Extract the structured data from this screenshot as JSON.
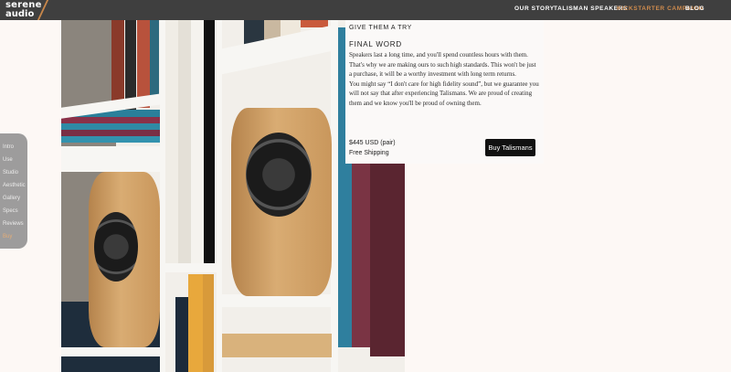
{
  "brand": {
    "line1": "serene",
    "line2": "audio"
  },
  "nav": [
    {
      "label": "Our Story",
      "active": false
    },
    {
      "label": "Talisman Speakers",
      "active": false
    },
    {
      "label": "Kickstarter Campaign",
      "active": true
    },
    {
      "label": "Blog",
      "active": false
    }
  ],
  "sidenav": [
    {
      "label": "Intro",
      "active": false
    },
    {
      "label": "Use",
      "active": false
    },
    {
      "label": "Studio",
      "active": false
    },
    {
      "label": "Aesthetic",
      "active": false
    },
    {
      "label": "Gallery",
      "active": false
    },
    {
      "label": "Specs",
      "active": false
    },
    {
      "label": "Reviews",
      "active": false
    },
    {
      "label": "Buy",
      "active": true
    }
  ],
  "card": {
    "kicker": "GIVE THEM A TRY",
    "heading": "FINAL WORD",
    "paragraph1": "Speakers last a long time, and you'll spend countless hours with them. That's why we are making ours to such high standards. This won't be just a purchase, it will be a worthy investment with long term returns.",
    "paragraph2": "You might say “I don't care for high fidelity sound”, but we guarantee you will not say that after experiencing Talismans. We are proud of creating them and we know you'll be proud of owning them.",
    "price": "$445 USD (pair)",
    "shipping": "Free Shipping",
    "buy_label": "Buy Talismans"
  },
  "colors": {
    "accent": "#d08c4e",
    "topbar": "#3f3f3f",
    "button": "#111111"
  }
}
